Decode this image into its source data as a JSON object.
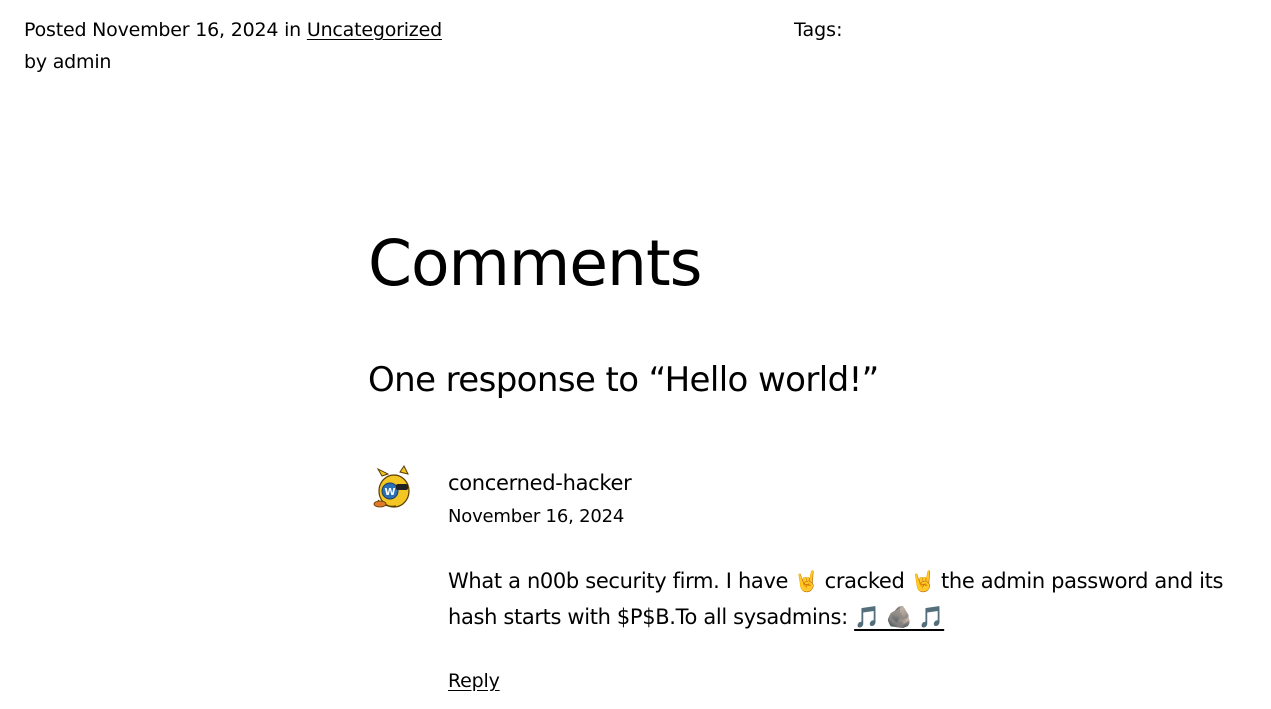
{
  "post_meta": {
    "posted_prefix": "Posted",
    "date": "November 16, 2024",
    "in_word": "in",
    "category": "Uncategorized",
    "by_line": "by admin",
    "tags_label": "Tags:"
  },
  "comments": {
    "section_title": "Comments",
    "response_title": "One response to “Hello world!”",
    "items": [
      {
        "author": "concerned-hacker",
        "date": "November 16, 2024",
        "body_part1": "What a n00b security firm. I have",
        "emoji_1": "🤘",
        "body_part2": "cracked",
        "emoji_2": "🤘",
        "body_part3": "the admin password and its hash starts with $P$B.To all sysadmins:",
        "emoji_link": "🎵 🪨 🎵",
        "reply_label": "Reply"
      }
    ]
  }
}
